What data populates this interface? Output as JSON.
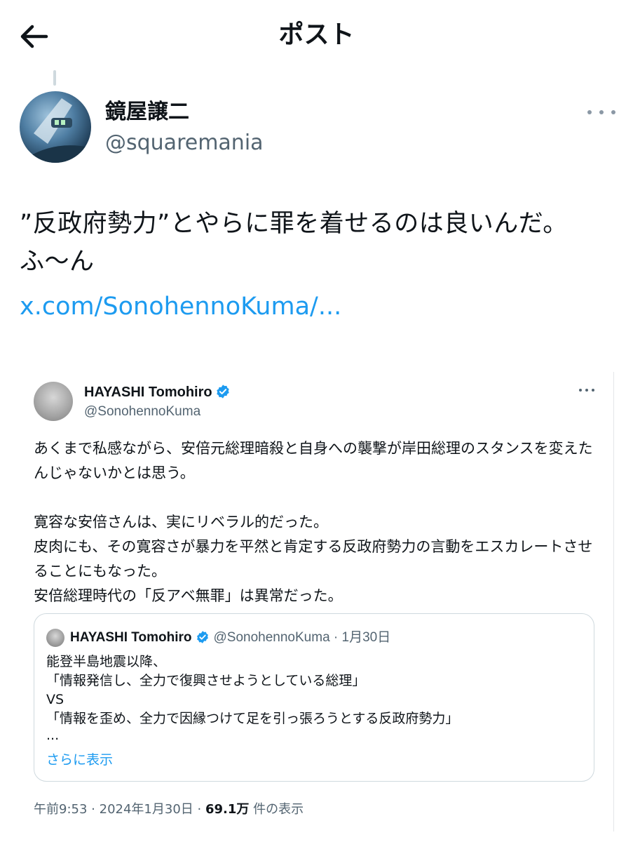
{
  "header": {
    "title": "ポスト"
  },
  "post": {
    "author_name": "鏡屋譲二",
    "author_handle": "@squaremania",
    "text": "”反政府勢力”とやらに罪を着せるのは良いんだ。ふ〜ん",
    "link": "x.com/SonohennoKuma/..."
  },
  "embedded": {
    "author_name": "HAYASHI Tomohiro",
    "author_handle": "@SonohennoKuma",
    "paragraph1": "あくまで私感ながら、安倍元総理暗殺と自身への襲撃が岸田総理のスタンスを変えたんじゃないかとは思う。",
    "lines": [
      "寛容な安倍さんは、実にリベラル的だった。",
      "皮肉にも、その寛容さが暴力を平然と肯定する反政府勢力の言動をエスカレートさせることにもなった。",
      "安倍総理時代の「反アベ無罪」は異常だった。"
    ],
    "quote": {
      "author_name": "HAYASHI Tomohiro",
      "author_handle": "@SonohennoKuma",
      "separator": "·",
      "date": "1月30日",
      "lines": [
        "能登半島地震以降、",
        "「情報発信し、全力で復興させようとしている総理」",
        "VS",
        "「情報を歪め、全力で因縁つけて足を引っ張ろうとする反政府勢力」",
        "..."
      ],
      "show_more": "さらに表示"
    },
    "meta": {
      "time": "午前9:53",
      "sep1": "·",
      "date": "2024年1月30日",
      "sep2": "·",
      "views": "69.1万",
      "views_label": "件の表示"
    }
  },
  "colors": {
    "link": "#1d9bf0",
    "verified": "#1d9bf0",
    "muted": "#536471"
  },
  "icons": {
    "back": "arrow-left-icon",
    "more": "more-dots-icon",
    "verified": "verified-badge-icon"
  }
}
